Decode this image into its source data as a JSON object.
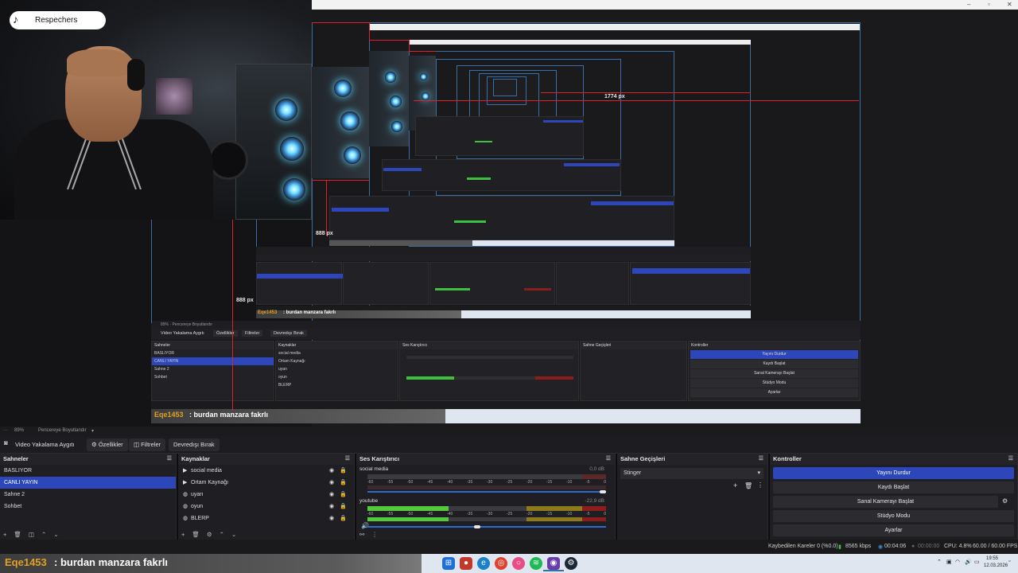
{
  "tiktok": {
    "handle": "Respechers"
  },
  "capture": {
    "px_labels": [
      "1774 px",
      "888 px",
      "888 px"
    ],
    "inner_chat_user": "Eqe1453",
    "inner_chat_msg": ": burdan manzara fakrlı",
    "inner_chat_user2": "Eqe1453",
    "inner_chat_msg2": ": burdan manzara fakrlı",
    "mini": {
      "scenes_title": "Sahneler",
      "scenes": [
        "BASLIYOR",
        "CANLI YAYIN",
        "Sahne 2",
        "Sohbet"
      ],
      "sources_title": "Kaynaklar",
      "sources": [
        "social media",
        "Ortam Kaynağı",
        "uyarı",
        "oyun",
        "BLERP"
      ],
      "mixer_title": "Ses Karıştırıcı",
      "transitions_title": "Sahne Geçişleri",
      "controls_title": "Kontroller",
      "controls": [
        "Yayını Durdur",
        "Kaydı Başlat",
        "Sanal Kamerayı Başlat",
        "Stüdyo Modu",
        "Ayarlar"
      ],
      "toolbar": [
        "Video Yakalama Aygıtı",
        "Özellikler",
        "Filtreler",
        "Devredışı Bırak"
      ]
    }
  },
  "zoombar": {
    "zoom": "89%",
    "fit": "Pencereye Boyutlandır"
  },
  "toolbar": {
    "source_name": "Video Yakalama Aygıtı",
    "properties": "Özellikler",
    "filters": "Filtreler",
    "disable": "Devredışı Bırak"
  },
  "scenes": {
    "title": "Sahneler",
    "items": [
      "BASLIYOR",
      "CANLI YAYIN",
      "Sahne 2",
      "Sohbet"
    ],
    "selected": 1
  },
  "sources": {
    "title": "Kaynaklar",
    "items": [
      "social media",
      "Ortam Kaynağı",
      "uyarı",
      "oyun",
      "BLERP"
    ]
  },
  "mixer": {
    "title": "Ses Karıştırıcı",
    "tracks": [
      {
        "name": "social media",
        "db": "0,0 dB",
        "level": 0.0
      },
      {
        "name": "youtube",
        "db": "-22,9 dB",
        "level": 0.34
      }
    ],
    "ticks": [
      "-60",
      "-55",
      "-50",
      "-45",
      "-40",
      "-35",
      "-30",
      "-25",
      "-20",
      "-15",
      "-10",
      "-5",
      "0"
    ]
  },
  "transitions": {
    "title": "Sahne Geçişleri",
    "selected": "Stinger"
  },
  "controls": {
    "title": "Kontroller",
    "buttons": [
      "Yayını Durdur",
      "Kaydı Başlat",
      "Sanal Kamerayı Başlat",
      "Stüdyo Modu",
      "Ayarlar"
    ]
  },
  "status": {
    "dropped": "Kaybedilen Kareler 0 (%0.0)",
    "bitrate": "8565 kbps",
    "live_time": "00:04:06",
    "rec_time": "00:00:00",
    "cpu": "CPU: 4.8%",
    "fps": "60.00 / 60.00 FPS"
  },
  "chat": {
    "user": "Eqe1453",
    "message": ": burdan manzara fakrlı"
  },
  "tray": {
    "time": "19:55",
    "date": "12.03.2026"
  }
}
